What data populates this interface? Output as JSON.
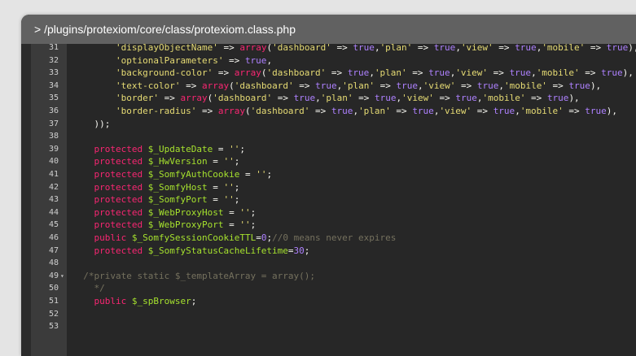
{
  "window": {
    "title": "> /plugins/protexiom/core/class/protexiom.class.php"
  },
  "colors": {
    "keyword": "#f92672",
    "variable": "#a6e22e",
    "string": "#e6db74",
    "comment": "#75715e",
    "number": "#ae81ff",
    "plain": "#f8f8f2"
  },
  "editor": {
    "lines": [
      {
        "num": "31",
        "fold": "",
        "tokens": [
          [
            "p",
            "        "
          ],
          [
            "s",
            "'displayObjectName'"
          ],
          [
            "p",
            " => "
          ],
          [
            "k",
            "array"
          ],
          [
            "p",
            "("
          ],
          [
            "s",
            "'dashboard'"
          ],
          [
            "p",
            " => "
          ],
          [
            "n",
            "true"
          ],
          [
            "p",
            ","
          ],
          [
            "s",
            "'plan'"
          ],
          [
            "p",
            " => "
          ],
          [
            "n",
            "true"
          ],
          [
            "p",
            ","
          ],
          [
            "s",
            "'view'"
          ],
          [
            "p",
            " => "
          ],
          [
            "n",
            "true"
          ],
          [
            "p",
            ","
          ],
          [
            "s",
            "'mobile'"
          ],
          [
            "p",
            " => "
          ],
          [
            "n",
            "true"
          ],
          [
            "p",
            "),"
          ]
        ]
      },
      {
        "num": "32",
        "fold": "",
        "tokens": [
          [
            "p",
            "        "
          ],
          [
            "s",
            "'optionalParameters'"
          ],
          [
            "p",
            " => "
          ],
          [
            "n",
            "true"
          ],
          [
            "p",
            ","
          ]
        ]
      },
      {
        "num": "33",
        "fold": "",
        "tokens": [
          [
            "p",
            "        "
          ],
          [
            "s",
            "'background-color'"
          ],
          [
            "p",
            " => "
          ],
          [
            "k",
            "array"
          ],
          [
            "p",
            "("
          ],
          [
            "s",
            "'dashboard'"
          ],
          [
            "p",
            " => "
          ],
          [
            "n",
            "true"
          ],
          [
            "p",
            ","
          ],
          [
            "s",
            "'plan'"
          ],
          [
            "p",
            " => "
          ],
          [
            "n",
            "true"
          ],
          [
            "p",
            ","
          ],
          [
            "s",
            "'view'"
          ],
          [
            "p",
            " => "
          ],
          [
            "n",
            "true"
          ],
          [
            "p",
            ","
          ],
          [
            "s",
            "'mobile'"
          ],
          [
            "p",
            " => "
          ],
          [
            "n",
            "true"
          ],
          [
            "p",
            "),"
          ]
        ]
      },
      {
        "num": "34",
        "fold": "",
        "tokens": [
          [
            "p",
            "        "
          ],
          [
            "s",
            "'text-color'"
          ],
          [
            "p",
            " => "
          ],
          [
            "k",
            "array"
          ],
          [
            "p",
            "("
          ],
          [
            "s",
            "'dashboard'"
          ],
          [
            "p",
            " => "
          ],
          [
            "n",
            "true"
          ],
          [
            "p",
            ","
          ],
          [
            "s",
            "'plan'"
          ],
          [
            "p",
            " => "
          ],
          [
            "n",
            "true"
          ],
          [
            "p",
            ","
          ],
          [
            "s",
            "'view'"
          ],
          [
            "p",
            " => "
          ],
          [
            "n",
            "true"
          ],
          [
            "p",
            ","
          ],
          [
            "s",
            "'mobile'"
          ],
          [
            "p",
            " => "
          ],
          [
            "n",
            "true"
          ],
          [
            "p",
            "),"
          ]
        ]
      },
      {
        "num": "35",
        "fold": "",
        "tokens": [
          [
            "p",
            "        "
          ],
          [
            "s",
            "'border'"
          ],
          [
            "p",
            " => "
          ],
          [
            "k",
            "array"
          ],
          [
            "p",
            "("
          ],
          [
            "s",
            "'dashboard'"
          ],
          [
            "p",
            " => "
          ],
          [
            "n",
            "true"
          ],
          [
            "p",
            ","
          ],
          [
            "s",
            "'plan'"
          ],
          [
            "p",
            " => "
          ],
          [
            "n",
            "true"
          ],
          [
            "p",
            ","
          ],
          [
            "s",
            "'view'"
          ],
          [
            "p",
            " => "
          ],
          [
            "n",
            "true"
          ],
          [
            "p",
            ","
          ],
          [
            "s",
            "'mobile'"
          ],
          [
            "p",
            " => "
          ],
          [
            "n",
            "true"
          ],
          [
            "p",
            "),"
          ]
        ]
      },
      {
        "num": "36",
        "fold": "",
        "tokens": [
          [
            "p",
            "        "
          ],
          [
            "s",
            "'border-radius'"
          ],
          [
            "p",
            " => "
          ],
          [
            "k",
            "array"
          ],
          [
            "p",
            "("
          ],
          [
            "s",
            "'dashboard'"
          ],
          [
            "p",
            " => "
          ],
          [
            "n",
            "true"
          ],
          [
            "p",
            ","
          ],
          [
            "s",
            "'plan'"
          ],
          [
            "p",
            " => "
          ],
          [
            "n",
            "true"
          ],
          [
            "p",
            ","
          ],
          [
            "s",
            "'view'"
          ],
          [
            "p",
            " => "
          ],
          [
            "n",
            "true"
          ],
          [
            "p",
            ","
          ],
          [
            "s",
            "'mobile'"
          ],
          [
            "p",
            " => "
          ],
          [
            "n",
            "true"
          ],
          [
            "p",
            "),"
          ]
        ]
      },
      {
        "num": "37",
        "fold": "",
        "tokens": [
          [
            "p",
            "    ));"
          ]
        ]
      },
      {
        "num": "38",
        "fold": "",
        "tokens": []
      },
      {
        "num": "39",
        "fold": "",
        "tokens": [
          [
            "p",
            "    "
          ],
          [
            "k",
            "protected"
          ],
          [
            "p",
            " "
          ],
          [
            "v",
            "$_UpdateDate"
          ],
          [
            "p",
            " = "
          ],
          [
            "s",
            "''"
          ],
          [
            "p",
            ";"
          ]
        ]
      },
      {
        "num": "40",
        "fold": "",
        "tokens": [
          [
            "p",
            "    "
          ],
          [
            "k",
            "protected"
          ],
          [
            "p",
            " "
          ],
          [
            "v",
            "$_HwVersion"
          ],
          [
            "p",
            " = "
          ],
          [
            "s",
            "''"
          ],
          [
            "p",
            ";"
          ]
        ]
      },
      {
        "num": "41",
        "fold": "",
        "tokens": [
          [
            "p",
            "    "
          ],
          [
            "k",
            "protected"
          ],
          [
            "p",
            " "
          ],
          [
            "v",
            "$_SomfyAuthCookie"
          ],
          [
            "p",
            " = "
          ],
          [
            "s",
            "''"
          ],
          [
            "p",
            ";"
          ]
        ]
      },
      {
        "num": "42",
        "fold": "",
        "tokens": [
          [
            "p",
            "    "
          ],
          [
            "k",
            "protected"
          ],
          [
            "p",
            " "
          ],
          [
            "v",
            "$_SomfyHost"
          ],
          [
            "p",
            " = "
          ],
          [
            "s",
            "''"
          ],
          [
            "p",
            ";"
          ]
        ]
      },
      {
        "num": "43",
        "fold": "",
        "tokens": [
          [
            "p",
            "    "
          ],
          [
            "k",
            "protected"
          ],
          [
            "p",
            " "
          ],
          [
            "v",
            "$_SomfyPort"
          ],
          [
            "p",
            " = "
          ],
          [
            "s",
            "''"
          ],
          [
            "p",
            ";"
          ]
        ]
      },
      {
        "num": "44",
        "fold": "",
        "tokens": [
          [
            "p",
            "    "
          ],
          [
            "k",
            "protected"
          ],
          [
            "p",
            " "
          ],
          [
            "v",
            "$_WebProxyHost"
          ],
          [
            "p",
            " = "
          ],
          [
            "s",
            "''"
          ],
          [
            "p",
            ";"
          ]
        ]
      },
      {
        "num": "45",
        "fold": "",
        "tokens": [
          [
            "p",
            "    "
          ],
          [
            "k",
            "protected"
          ],
          [
            "p",
            " "
          ],
          [
            "v",
            "$_WebProxyPort"
          ],
          [
            "p",
            " = "
          ],
          [
            "s",
            "''"
          ],
          [
            "p",
            ";"
          ]
        ]
      },
      {
        "num": "46",
        "fold": "",
        "tokens": [
          [
            "p",
            "    "
          ],
          [
            "k",
            "public"
          ],
          [
            "p",
            " "
          ],
          [
            "v",
            "$_SomfySessionCookieTTL"
          ],
          [
            "p",
            "="
          ],
          [
            "n",
            "0"
          ],
          [
            "p",
            ";"
          ],
          [
            "c",
            "//0 means never expires"
          ]
        ]
      },
      {
        "num": "47",
        "fold": "",
        "tokens": [
          [
            "p",
            "    "
          ],
          [
            "k",
            "protected"
          ],
          [
            "p",
            " "
          ],
          [
            "v",
            "$_SomfyStatusCacheLifetime"
          ],
          [
            "p",
            "="
          ],
          [
            "n",
            "30"
          ],
          [
            "p",
            ";"
          ]
        ]
      },
      {
        "num": "48",
        "fold": "",
        "tokens": []
      },
      {
        "num": "49",
        "fold": "▾",
        "tokens": [
          [
            "p",
            "  "
          ],
          [
            "c",
            "/*private static $_templateArray = array();"
          ]
        ]
      },
      {
        "num": "50",
        "fold": "",
        "tokens": [
          [
            "c",
            "    */"
          ]
        ]
      },
      {
        "num": "51",
        "fold": "",
        "tokens": [
          [
            "p",
            "    "
          ],
          [
            "k",
            "public"
          ],
          [
            "p",
            " "
          ],
          [
            "v",
            "$_spBrowser"
          ],
          [
            "p",
            ";"
          ]
        ]
      },
      {
        "num": "52",
        "fold": "",
        "tokens": []
      },
      {
        "num": "53",
        "fold": "",
        "tokens": []
      }
    ]
  }
}
